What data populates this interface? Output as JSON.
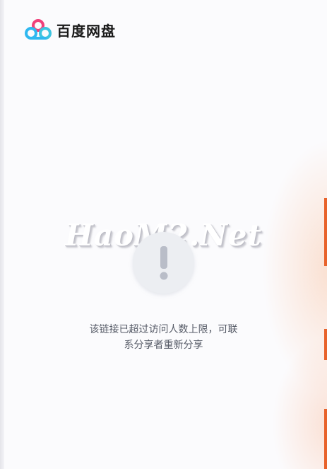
{
  "header": {
    "logo_icon": "baidu-netdisk-logo-icon",
    "brand_name": "百度网盘"
  },
  "watermark": {
    "text": "HaoM2.Net"
  },
  "notice": {
    "icon": "exclamation-icon",
    "message_line1": "该链接已超过访问人数上限，可联",
    "message_line2": "系分享者重新分享"
  },
  "colors": {
    "accent_orange": "#e8622a",
    "logo_blue": "#2fb8f0",
    "logo_pink": "#f0407a",
    "text_gray": "#555a66"
  }
}
